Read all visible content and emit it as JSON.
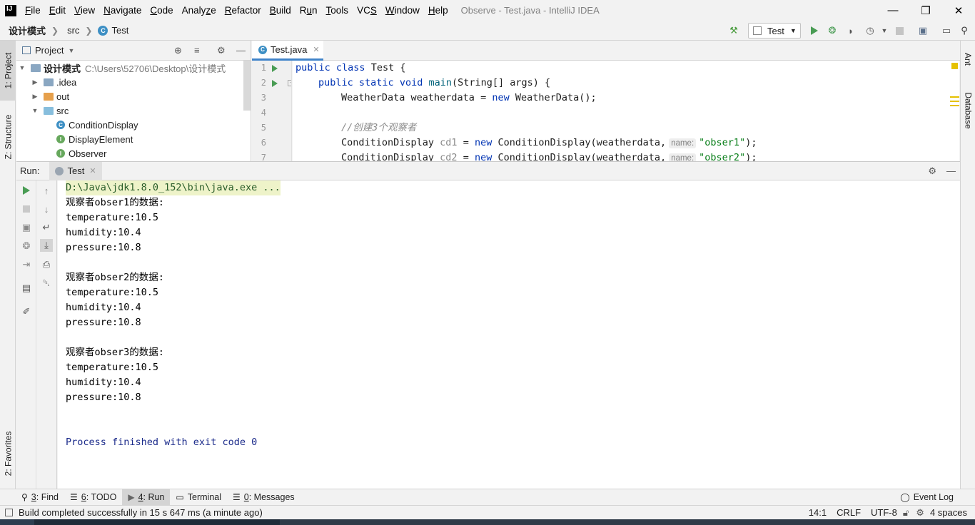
{
  "window": {
    "logo": "IJ",
    "title": "Observe - Test.java - IntelliJ IDEA",
    "menu": [
      {
        "pre": "",
        "u": "F",
        "post": "ile"
      },
      {
        "pre": "",
        "u": "E",
        "post": "dit"
      },
      {
        "pre": "",
        "u": "V",
        "post": "iew"
      },
      {
        "pre": "",
        "u": "N",
        "post": "avigate"
      },
      {
        "pre": "",
        "u": "C",
        "post": "ode"
      },
      {
        "pre": "Analy",
        "u": "z",
        "post": "e"
      },
      {
        "pre": "",
        "u": "R",
        "post": "efactor"
      },
      {
        "pre": "",
        "u": "B",
        "post": "uild"
      },
      {
        "pre": "R",
        "u": "u",
        "post": "n"
      },
      {
        "pre": "",
        "u": "T",
        "post": "ools"
      },
      {
        "pre": "VC",
        "u": "S",
        "post": ""
      },
      {
        "pre": "",
        "u": "W",
        "post": "indow"
      },
      {
        "pre": "",
        "u": "H",
        "post": "elp"
      }
    ],
    "controls": {
      "minimize": "—",
      "restore": "❐",
      "close": "✕"
    }
  },
  "navbar": {
    "crumbs": [
      "设计模式",
      "src",
      "Test"
    ],
    "run_config": "Test"
  },
  "left_strip": {
    "project_tab": "1: Project",
    "structure_tab": "Z: Structure",
    "favorites_tab": "2: Favorites"
  },
  "right_strip": {
    "ant_tab": "Ant",
    "database_tab": "Database"
  },
  "project_panel": {
    "title": "Project",
    "tree": [
      {
        "label": "设计模式",
        "hint": "C:\\Users\\52706\\Desktop\\设计模式",
        "kind": "module"
      },
      {
        "label": ".idea",
        "kind": "folder"
      },
      {
        "label": "out",
        "kind": "folder-orange"
      },
      {
        "label": "src",
        "kind": "folder-blue"
      },
      {
        "label": "ConditionDisplay",
        "kind": "class"
      },
      {
        "label": "DisplayElement",
        "kind": "interface"
      },
      {
        "label": "Observer",
        "kind": "interface"
      }
    ]
  },
  "editor": {
    "tab_label": "Test.java",
    "line_numbers": [
      "1",
      "2",
      "3",
      "4",
      "5",
      "6",
      "7"
    ],
    "line3": "WeatherData weatherdata = ",
    "line3_new": "new",
    "line3_rest": " WeatherData();",
    "line5_comment": "//创建3个观察者",
    "line6_a": "ConditionDisplay ",
    "line6_var": "cd1",
    "line6_b": " = ",
    "line6_new": "new",
    "line6_c": " ConditionDisplay(weatherdata,",
    "line6_hint": "name:",
    "line6_str": "\"obser1\"",
    "line6_end": ");",
    "line7_a": "ConditionDisplay ",
    "line7_var": "cd2",
    "line7_b": " = ",
    "line7_new": "new",
    "line7_c": " ConditionDisplay(weatherdata,",
    "line7_hint": "name:",
    "line7_str": "\"obser2\"",
    "line7_end": ");",
    "kw_public": "public",
    "kw_class": "class",
    "kw_static": "static",
    "kw_void": "void",
    "class_name": " Test {",
    "fn_main": "main",
    "main_args": "(String[] args) {"
  },
  "run_panel": {
    "label": "Run:",
    "tab": "Test",
    "console": [
      {
        "text": "D:\\Java\\jdk1.8.0_152\\bin\\java.exe ...",
        "kind": "cmd"
      },
      {
        "text": "观察者obser1的数据:",
        "kind": "out"
      },
      {
        "text": "temperature:10.5",
        "kind": "out"
      },
      {
        "text": "humidity:10.4",
        "kind": "out"
      },
      {
        "text": "pressure:10.8",
        "kind": "out"
      },
      {
        "text": "",
        "kind": "out"
      },
      {
        "text": "观察者obser2的数据:",
        "kind": "out"
      },
      {
        "text": "temperature:10.5",
        "kind": "out"
      },
      {
        "text": "humidity:10.4",
        "kind": "out"
      },
      {
        "text": "pressure:10.8",
        "kind": "out"
      },
      {
        "text": "",
        "kind": "out"
      },
      {
        "text": "观察者obser3的数据:",
        "kind": "out"
      },
      {
        "text": "temperature:10.5",
        "kind": "out"
      },
      {
        "text": "humidity:10.4",
        "kind": "out"
      },
      {
        "text": "pressure:10.8",
        "kind": "out"
      },
      {
        "text": "",
        "kind": "out"
      },
      {
        "text": "",
        "kind": "out"
      },
      {
        "text": "Process finished with exit code 0",
        "kind": "exit"
      }
    ]
  },
  "bottom_tools": [
    {
      "icon": "search-icon",
      "num": "3",
      "label": ": Find"
    },
    {
      "icon": "todo-icon",
      "num": "6",
      "label": ": TODO"
    },
    {
      "icon": "run-icon",
      "num": "4",
      "label": ": Run"
    },
    {
      "icon": "terminal-icon",
      "num": "",
      "label": "Terminal"
    },
    {
      "icon": "messages-icon",
      "num": "0",
      "label": ": Messages"
    }
  ],
  "event_log": "Event Log",
  "status": {
    "message": "Build completed successfully in 15 s 647 ms (a minute ago)",
    "position": "14:1",
    "line_sep": "CRLF",
    "encoding": "UTF-8",
    "indent": "4 spaces"
  },
  "colors": {
    "accent": "#4083c9",
    "run_green": "#499c54",
    "keyword": "#0033b3",
    "string": "#067d17"
  }
}
